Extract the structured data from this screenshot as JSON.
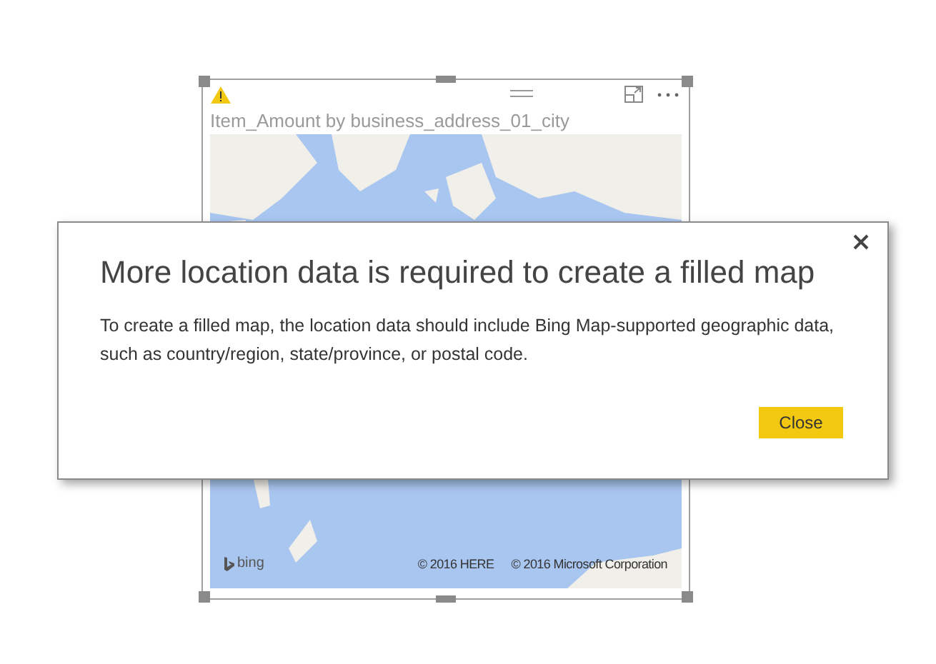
{
  "visual": {
    "title": "Item_Amount by business_address_01_city",
    "warning": true,
    "map": {
      "kind": "picture",
      "logo_text": "bing",
      "attributions": [
        "© 2016 HERE",
        "© 2016 Microsoft Corporation"
      ]
    }
  },
  "dialog": {
    "title": "More location data is required to create a filled map",
    "message": "To create a filled map, the location data should include Bing Map-supported geographic data, such as country/region, state/province, or postal code.",
    "buttons": [
      "Close"
    ]
  }
}
